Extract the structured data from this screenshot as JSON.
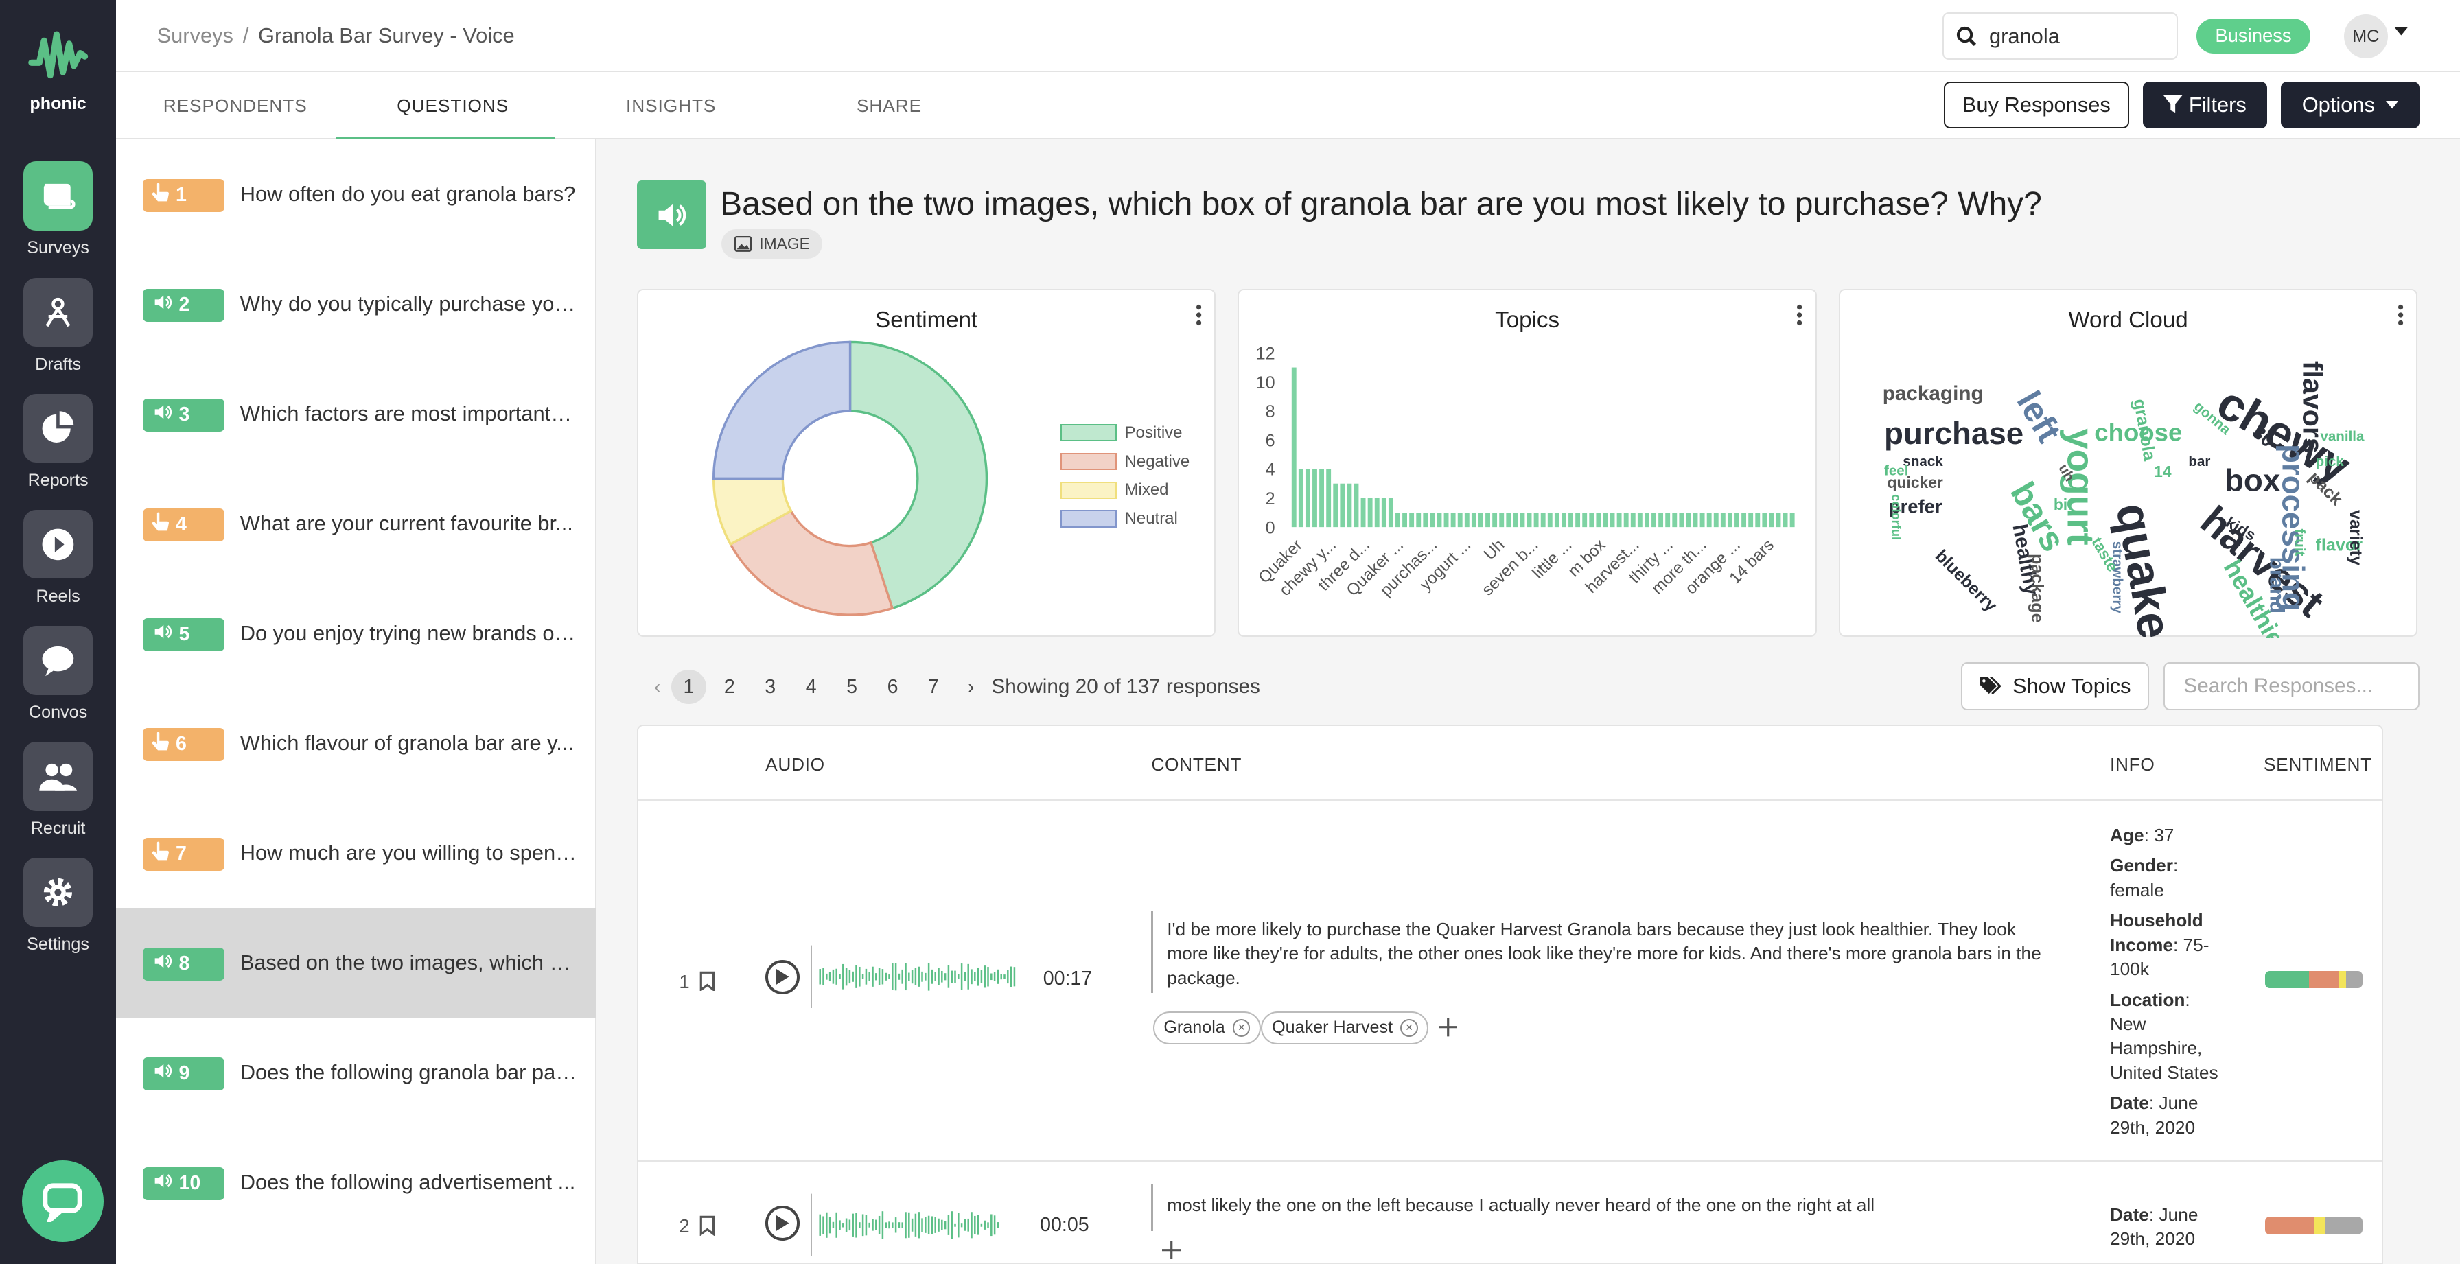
{
  "brand": {
    "name": "phonic",
    "accent": "#5bbf86"
  },
  "nav": [
    {
      "label": "Surveys",
      "icon": "surveys-icon",
      "active": true
    },
    {
      "label": "Drafts",
      "icon": "drafts-icon"
    },
    {
      "label": "Reports",
      "icon": "reports-icon"
    },
    {
      "label": "Reels",
      "icon": "reels-icon"
    },
    {
      "label": "Convos",
      "icon": "convos-icon"
    },
    {
      "label": "Recruit",
      "icon": "recruit-icon"
    },
    {
      "label": "Settings",
      "icon": "settings-icon"
    }
  ],
  "header": {
    "breadcrumb_root": "Surveys",
    "breadcrumb_sep": "/",
    "breadcrumb_current": "Granola Bar Survey - Voice",
    "search_value": "granola",
    "plan_badge": "Business",
    "avatar_initials": "MC"
  },
  "tabs": {
    "respondents": "RESPONDENTS",
    "questions": "QUESTIONS",
    "insights": "INSIGHTS",
    "share": "SHARE"
  },
  "actions": {
    "buy": "Buy Responses",
    "filters": "Filters",
    "options": "Options"
  },
  "questions": [
    {
      "num": "1",
      "type": "tap",
      "text": "How often do you eat granola bars?"
    },
    {
      "num": "2",
      "type": "voice",
      "text": "Why do you typically purchase you..."
    },
    {
      "num": "3",
      "type": "voice",
      "text": "Which factors are most important t..."
    },
    {
      "num": "4",
      "type": "tap",
      "text": "What are your current favourite br..."
    },
    {
      "num": "5",
      "type": "voice",
      "text": "Do you enjoy trying new brands or ..."
    },
    {
      "num": "6",
      "type": "tap",
      "text": "Which flavour of granola bar are y..."
    },
    {
      "num": "7",
      "type": "tap",
      "text": "How much are you willing to spend..."
    },
    {
      "num": "8",
      "type": "voice",
      "text": "Based on the two images, which b...",
      "selected": true
    },
    {
      "num": "9",
      "type": "voice",
      "text": "Does the following granola bar pac..."
    },
    {
      "num": "10",
      "type": "voice",
      "text": "Does the following advertisement ..."
    }
  ],
  "question": {
    "title": "Based on the two images, which box of granola bar are you most likely to purchase? Why?",
    "media_badge": "IMAGE"
  },
  "cards": {
    "sentiment": "Sentiment",
    "topics": "Topics",
    "wordcloud": "Word Cloud"
  },
  "chart_data": [
    {
      "type": "pie",
      "title": "Sentiment",
      "labels": [
        "Positive",
        "Negative",
        "Mixed",
        "Neutral"
      ],
      "values": [
        45,
        22,
        8,
        25
      ],
      "colors": [
        "#bfe8cf",
        "#f2d2c7",
        "#fbf3c4",
        "#c8d2ec"
      ],
      "borders": [
        "#5bbf86",
        "#e0947a",
        "#f0df7d",
        "#8296cc"
      ],
      "legend": "right"
    },
    {
      "type": "bar",
      "title": "Topics",
      "categories": [
        "Quaker",
        "chewy y...",
        "three d...",
        "Quaker ...",
        "purchas...",
        "yogurt ...",
        "Uh",
        "seven b...",
        "little ...",
        "m box",
        "harvest...",
        "thirty ...",
        "more th...",
        "orange ...",
        "14 bars"
      ],
      "values": [
        11,
        4,
        4,
        4,
        4,
        4,
        3,
        3,
        3,
        3,
        2,
        2,
        2,
        2,
        2,
        1,
        1,
        1,
        1,
        1,
        1,
        1,
        1,
        1,
        1,
        1,
        1,
        1,
        1,
        1,
        1,
        1,
        1,
        1,
        1,
        1,
        1,
        1,
        1,
        1,
        1,
        1,
        1,
        1,
        1,
        1,
        1,
        1,
        1,
        1,
        1,
        1,
        1,
        1,
        1,
        1,
        1,
        1,
        1,
        1,
        1,
        1,
        1,
        1,
        1,
        1,
        1,
        1,
        1,
        1,
        1,
        1,
        1
      ],
      "yticks": [
        0,
        2,
        4,
        6,
        8,
        10,
        12
      ],
      "ylim": [
        0,
        12
      ],
      "color": "#7ed3a3"
    }
  ],
  "wordcloud": {
    "words": [
      {
        "t": "chewy",
        "s": 30,
        "c": "#2b2f3a",
        "r": 30
      },
      {
        "t": "quaker",
        "s": 30,
        "c": "#2b2f3a",
        "r": 80
      },
      {
        "t": "harvest",
        "s": 26,
        "c": "#2b2f3a",
        "r": 40
      },
      {
        "t": "yogurt",
        "s": 24,
        "c": "#5bbf86",
        "r": 90
      },
      {
        "t": "processing",
        "s": 20,
        "c": "#5f7da1",
        "r": 90
      },
      {
        "t": "purchase",
        "s": 20,
        "c": "#2b2f3a",
        "r": 0
      },
      {
        "t": "flavors",
        "s": 18,
        "c": "#2b2f3a",
        "r": 90
      },
      {
        "t": "left",
        "s": 22,
        "c": "#5f7da1",
        "r": 60
      },
      {
        "t": "bars",
        "s": 22,
        "c": "#5bbf86",
        "r": 60
      },
      {
        "t": "box",
        "s": 20,
        "c": "#2b2f3a",
        "r": 0
      },
      {
        "t": "choose",
        "s": 16,
        "c": "#5bbf86",
        "r": 0
      },
      {
        "t": "healthier",
        "s": 16,
        "c": "#5bbf86",
        "r": 60
      },
      {
        "t": "packaging",
        "s": 13,
        "c": "#555",
        "r": 0
      },
      {
        "t": "healthy",
        "s": 13,
        "c": "#2b2f3a",
        "r": 80
      },
      {
        "t": "brand",
        "s": 13,
        "c": "#5f7da1",
        "r": 90
      },
      {
        "t": "prefer",
        "s": 12,
        "c": "#2b2f3a",
        "r": 0
      },
      {
        "t": "package",
        "s": 11,
        "c": "#555",
        "r": 90
      },
      {
        "t": "blueberry",
        "s": 11,
        "c": "#2b2f3a",
        "r": 45
      },
      {
        "t": "flavor",
        "s": 11,
        "c": "#5bbf86",
        "r": 0
      },
      {
        "t": "variety",
        "s": 11,
        "c": "#2b2f3a",
        "r": 90
      },
      {
        "t": "pack",
        "s": 11,
        "c": "#555",
        "r": 45
      },
      {
        "t": "granola",
        "s": 11,
        "c": "#5bbf86",
        "r": 80
      },
      {
        "t": "strawberry",
        "s": 9,
        "c": "#5f7da1",
        "r": 90
      },
      {
        "t": "taste",
        "s": 10,
        "c": "#5bbf86",
        "r": 60
      },
      {
        "t": "kids",
        "s": 10,
        "c": "#2b2f3a",
        "r": 30
      },
      {
        "t": "quicker",
        "s": 10,
        "c": "#555",
        "r": 0
      },
      {
        "t": "snack",
        "s": 9,
        "c": "#2b2f3a",
        "r": 0
      },
      {
        "t": "bar",
        "s": 9,
        "c": "#2b2f3a",
        "r": 0
      },
      {
        "t": "pick",
        "s": 9,
        "c": "#5bbf86",
        "r": 0
      },
      {
        "t": "vanilla",
        "s": 9,
        "c": "#5bbf86",
        "r": 0
      },
      {
        "t": "30",
        "s": 12,
        "c": "#2b2f3a",
        "r": 40
      },
      {
        "t": "14",
        "s": 10,
        "c": "#5bbf86",
        "r": 0
      },
      {
        "t": "bit",
        "s": 10,
        "c": "#5bbf86",
        "r": 0
      },
      {
        "t": "fruit",
        "s": 9,
        "c": "#5bbf86",
        "r": 90
      },
      {
        "t": "gonna",
        "s": 9,
        "c": "#5bbf86",
        "r": 40
      },
      {
        "t": "feel",
        "s": 9,
        "c": "#5bbf86",
        "r": 0
      },
      {
        "t": "colorful",
        "s": 8,
        "c": "#5bbf86",
        "r": 90
      },
      {
        "t": "uh",
        "s": 9,
        "c": "#555",
        "r": 60
      }
    ]
  },
  "pagination": {
    "pages": [
      "1",
      "2",
      "3",
      "4",
      "5",
      "6",
      "7"
    ],
    "current": "1",
    "showing": "Showing 20 of 137 responses"
  },
  "show_topics": "Show Topics",
  "search_responses_placeholder": "Search Responses...",
  "table": {
    "headers": {
      "audio": "AUDIO",
      "content": "CONTENT",
      "info": "INFO",
      "sentiment": "SENTIMENT"
    },
    "rows": [
      {
        "num": "1",
        "duration": "00:17",
        "text": "I'd be more likely to purchase the Quaker Harvest Granola bars because they just look healthier. They look more like they're for adults, the other ones look like they're more for kids. And there's more granola bars in the package.",
        "tags": [
          "Granola",
          "Quaker Harvest"
        ],
        "info": {
          "age_label": "Age",
          "age": "37",
          "gender_label": "Gender",
          "gender": "female",
          "income_label": "Household Income",
          "income": "75-100k",
          "location_label": "Location",
          "location": "New Hampshire, United States",
          "date_label": "Date",
          "date": "June 29th, 2020"
        },
        "sentiment": [
          0.45,
          0.3,
          0.08,
          0.17
        ]
      },
      {
        "num": "2",
        "duration": "00:05",
        "text": "most likely the one on the left because I actually never heard of the one on the right at all",
        "tags": [],
        "info": {
          "date_label": "Date",
          "date": "June 29th, 2020"
        },
        "sentiment": [
          0.0,
          0.5,
          0.12,
          0.38
        ]
      }
    ]
  }
}
